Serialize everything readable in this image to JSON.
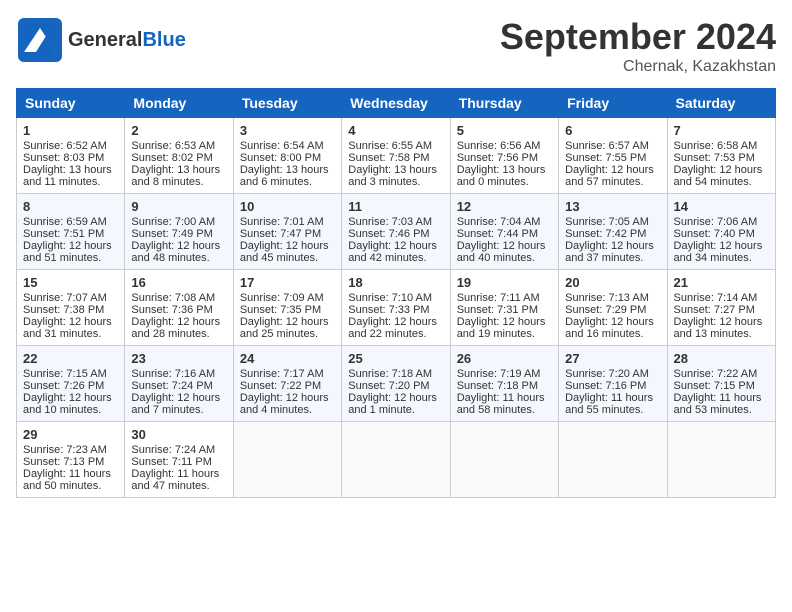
{
  "header": {
    "logo_general": "General",
    "logo_blue": "Blue",
    "month": "September 2024",
    "location": "Chernak, Kazakhstan"
  },
  "weekdays": [
    "Sunday",
    "Monday",
    "Tuesday",
    "Wednesday",
    "Thursday",
    "Friday",
    "Saturday"
  ],
  "weeks": [
    [
      {
        "day": "1",
        "lines": [
          "Sunrise: 6:52 AM",
          "Sunset: 8:03 PM",
          "Daylight: 13 hours",
          "and 11 minutes."
        ]
      },
      {
        "day": "2",
        "lines": [
          "Sunrise: 6:53 AM",
          "Sunset: 8:02 PM",
          "Daylight: 13 hours",
          "and 8 minutes."
        ]
      },
      {
        "day": "3",
        "lines": [
          "Sunrise: 6:54 AM",
          "Sunset: 8:00 PM",
          "Daylight: 13 hours",
          "and 6 minutes."
        ]
      },
      {
        "day": "4",
        "lines": [
          "Sunrise: 6:55 AM",
          "Sunset: 7:58 PM",
          "Daylight: 13 hours",
          "and 3 minutes."
        ]
      },
      {
        "day": "5",
        "lines": [
          "Sunrise: 6:56 AM",
          "Sunset: 7:56 PM",
          "Daylight: 13 hours",
          "and 0 minutes."
        ]
      },
      {
        "day": "6",
        "lines": [
          "Sunrise: 6:57 AM",
          "Sunset: 7:55 PM",
          "Daylight: 12 hours",
          "and 57 minutes."
        ]
      },
      {
        "day": "7",
        "lines": [
          "Sunrise: 6:58 AM",
          "Sunset: 7:53 PM",
          "Daylight: 12 hours",
          "and 54 minutes."
        ]
      }
    ],
    [
      {
        "day": "8",
        "lines": [
          "Sunrise: 6:59 AM",
          "Sunset: 7:51 PM",
          "Daylight: 12 hours",
          "and 51 minutes."
        ]
      },
      {
        "day": "9",
        "lines": [
          "Sunrise: 7:00 AM",
          "Sunset: 7:49 PM",
          "Daylight: 12 hours",
          "and 48 minutes."
        ]
      },
      {
        "day": "10",
        "lines": [
          "Sunrise: 7:01 AM",
          "Sunset: 7:47 PM",
          "Daylight: 12 hours",
          "and 45 minutes."
        ]
      },
      {
        "day": "11",
        "lines": [
          "Sunrise: 7:03 AM",
          "Sunset: 7:46 PM",
          "Daylight: 12 hours",
          "and 42 minutes."
        ]
      },
      {
        "day": "12",
        "lines": [
          "Sunrise: 7:04 AM",
          "Sunset: 7:44 PM",
          "Daylight: 12 hours",
          "and 40 minutes."
        ]
      },
      {
        "day": "13",
        "lines": [
          "Sunrise: 7:05 AM",
          "Sunset: 7:42 PM",
          "Daylight: 12 hours",
          "and 37 minutes."
        ]
      },
      {
        "day": "14",
        "lines": [
          "Sunrise: 7:06 AM",
          "Sunset: 7:40 PM",
          "Daylight: 12 hours",
          "and 34 minutes."
        ]
      }
    ],
    [
      {
        "day": "15",
        "lines": [
          "Sunrise: 7:07 AM",
          "Sunset: 7:38 PM",
          "Daylight: 12 hours",
          "and 31 minutes."
        ]
      },
      {
        "day": "16",
        "lines": [
          "Sunrise: 7:08 AM",
          "Sunset: 7:36 PM",
          "Daylight: 12 hours",
          "and 28 minutes."
        ]
      },
      {
        "day": "17",
        "lines": [
          "Sunrise: 7:09 AM",
          "Sunset: 7:35 PM",
          "Daylight: 12 hours",
          "and 25 minutes."
        ]
      },
      {
        "day": "18",
        "lines": [
          "Sunrise: 7:10 AM",
          "Sunset: 7:33 PM",
          "Daylight: 12 hours",
          "and 22 minutes."
        ]
      },
      {
        "day": "19",
        "lines": [
          "Sunrise: 7:11 AM",
          "Sunset: 7:31 PM",
          "Daylight: 12 hours",
          "and 19 minutes."
        ]
      },
      {
        "day": "20",
        "lines": [
          "Sunrise: 7:13 AM",
          "Sunset: 7:29 PM",
          "Daylight: 12 hours",
          "and 16 minutes."
        ]
      },
      {
        "day": "21",
        "lines": [
          "Sunrise: 7:14 AM",
          "Sunset: 7:27 PM",
          "Daylight: 12 hours",
          "and 13 minutes."
        ]
      }
    ],
    [
      {
        "day": "22",
        "lines": [
          "Sunrise: 7:15 AM",
          "Sunset: 7:26 PM",
          "Daylight: 12 hours",
          "and 10 minutes."
        ]
      },
      {
        "day": "23",
        "lines": [
          "Sunrise: 7:16 AM",
          "Sunset: 7:24 PM",
          "Daylight: 12 hours",
          "and 7 minutes."
        ]
      },
      {
        "day": "24",
        "lines": [
          "Sunrise: 7:17 AM",
          "Sunset: 7:22 PM",
          "Daylight: 12 hours",
          "and 4 minutes."
        ]
      },
      {
        "day": "25",
        "lines": [
          "Sunrise: 7:18 AM",
          "Sunset: 7:20 PM",
          "Daylight: 12 hours",
          "and 1 minute."
        ]
      },
      {
        "day": "26",
        "lines": [
          "Sunrise: 7:19 AM",
          "Sunset: 7:18 PM",
          "Daylight: 11 hours",
          "and 58 minutes."
        ]
      },
      {
        "day": "27",
        "lines": [
          "Sunrise: 7:20 AM",
          "Sunset: 7:16 PM",
          "Daylight: 11 hours",
          "and 55 minutes."
        ]
      },
      {
        "day": "28",
        "lines": [
          "Sunrise: 7:22 AM",
          "Sunset: 7:15 PM",
          "Daylight: 11 hours",
          "and 53 minutes."
        ]
      }
    ],
    [
      {
        "day": "29",
        "lines": [
          "Sunrise: 7:23 AM",
          "Sunset: 7:13 PM",
          "Daylight: 11 hours",
          "and 50 minutes."
        ]
      },
      {
        "day": "30",
        "lines": [
          "Sunrise: 7:24 AM",
          "Sunset: 7:11 PM",
          "Daylight: 11 hours",
          "and 47 minutes."
        ]
      },
      {
        "day": "",
        "lines": []
      },
      {
        "day": "",
        "lines": []
      },
      {
        "day": "",
        "lines": []
      },
      {
        "day": "",
        "lines": []
      },
      {
        "day": "",
        "lines": []
      }
    ]
  ]
}
